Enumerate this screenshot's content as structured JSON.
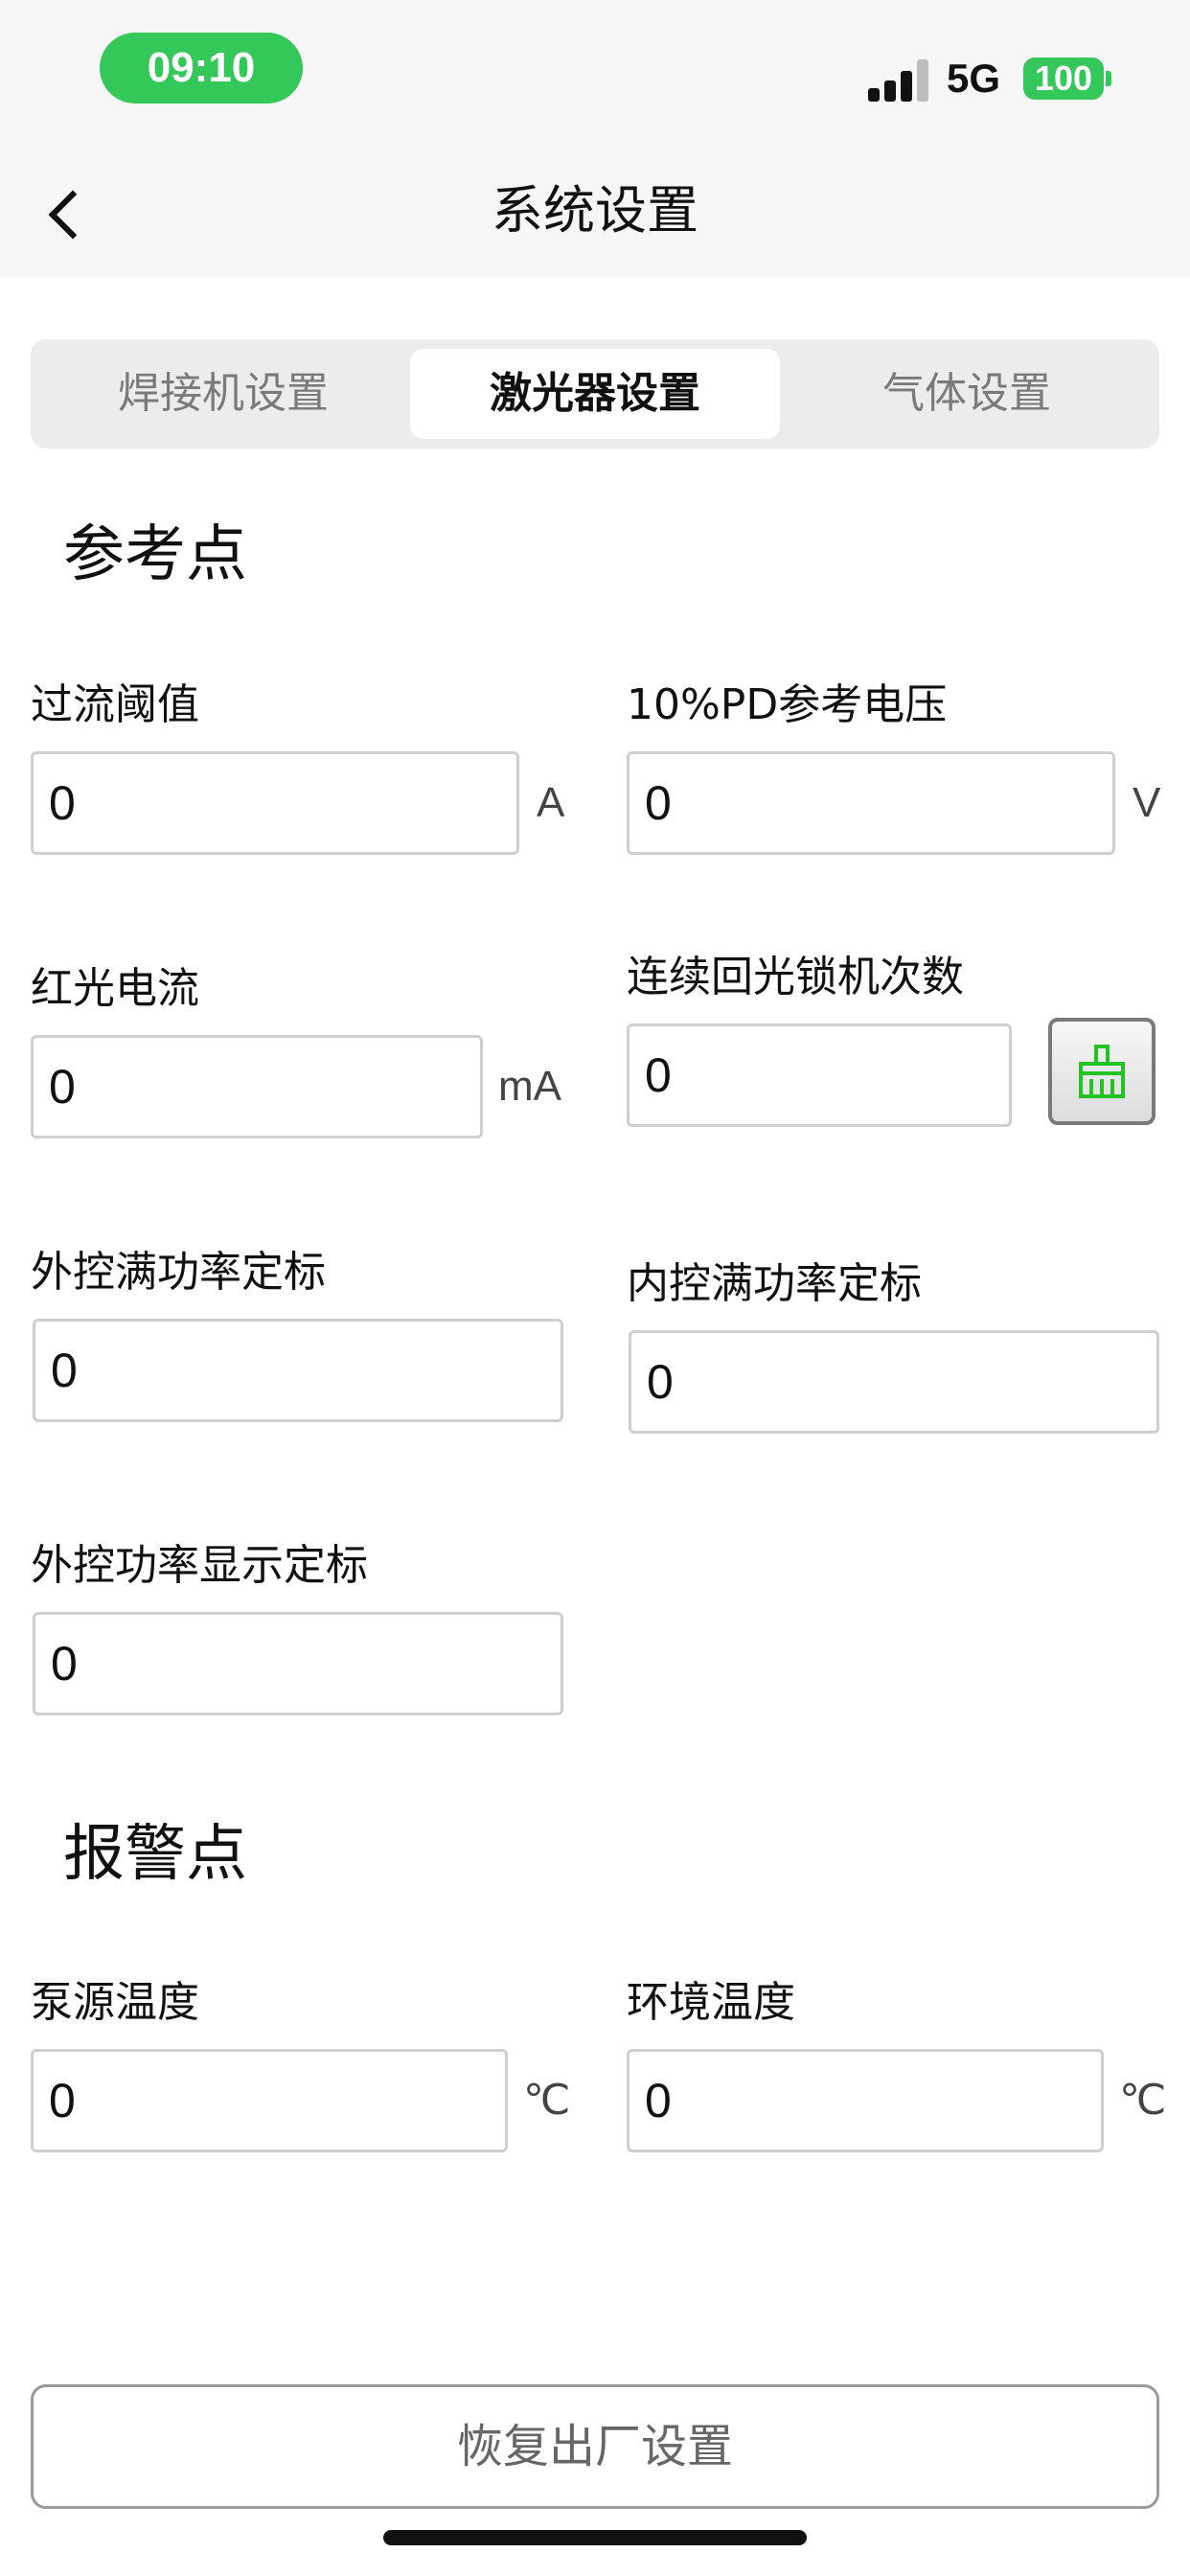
{
  "status_bar": {
    "time": "09:10",
    "network": "5G",
    "battery": "100",
    "signal_icon": "signal-bars-icon"
  },
  "nav": {
    "title": "系统设置",
    "back_icon": "chevron-left-icon"
  },
  "tabs": [
    {
      "label": "焊接机设置",
      "active": false
    },
    {
      "label": "激光器设置",
      "active": true
    },
    {
      "label": "气体设置",
      "active": false
    }
  ],
  "reference": {
    "title": "参考点",
    "overcurrent": {
      "label": "过流阈值",
      "value": "0",
      "unit": "A"
    },
    "pd_voltage": {
      "label": "10%PD参考电压",
      "value": "0",
      "unit": "V"
    },
    "red_current": {
      "label": "红光电流",
      "value": "0",
      "unit": "mA"
    },
    "lock_count": {
      "label": "连续回光锁机次数",
      "value": "0",
      "clear_icon": "broom-icon"
    },
    "ext_full_power": {
      "label": "外控满功率定标",
      "value": "0"
    },
    "int_full_power": {
      "label": "内控满功率定标",
      "value": "0"
    },
    "ext_power_display": {
      "label": "外控功率显示定标",
      "value": "0"
    }
  },
  "alarm": {
    "title": "报警点",
    "pump_temp": {
      "label": "泵源温度",
      "value": "0",
      "unit": "℃"
    },
    "env_temp": {
      "label": "环境温度",
      "value": "0",
      "unit": "℃"
    }
  },
  "footer": {
    "reset_label": "恢复出厂设置"
  },
  "colors": {
    "accent_green": "#34c759",
    "broom_green": "#22c322"
  }
}
